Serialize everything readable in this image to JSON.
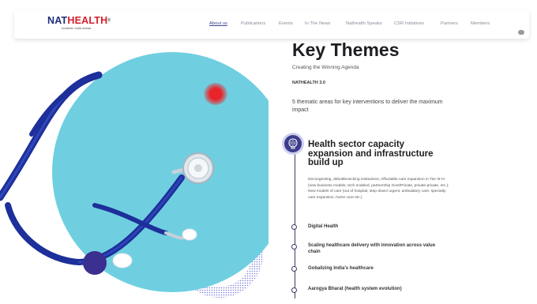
{
  "logo": {
    "name_part1": "NAT",
    "name_part2": "HEALTH",
    "trademark": "®",
    "tagline": "healthier India ahead"
  },
  "nav": {
    "items": [
      "About us",
      "Publications",
      "Events",
      "In The News",
      "Nathealth Speaks",
      "CSR Initiatives",
      "Partners",
      "Members"
    ],
    "active": "About us"
  },
  "hero": {
    "title": "Key Themes",
    "subtitle": "Creating the Winning Agenda",
    "tagline": "NATHEALTH 3.0",
    "description": "5 thematic areas for key interventions to deliver the maximum impact"
  },
  "timeline": {
    "icon": "brain-icon",
    "heading": "Health sector capacity expansion and infrastructure build up",
    "body": "Decongesting, debottlenecking institutions; Affordable care expansion in Tier III-IV (new business models, tech enabled, partnership Govt/Private, private-private, etc.); New models of care (out of hospital, step down/ urgent, ambulatory care, specialty care expansion, home care etc.)",
    "items": [
      "Digital Health",
      "Scaling healthcare delivery with innovation across value chain",
      "Gobalizing India's healthcare",
      "Aarogya Bharat (health system evolution)"
    ]
  },
  "colors": {
    "brand_navy": "#1f2d7a",
    "brand_red": "#d41f2a",
    "accent_purple": "#3b3d8a",
    "cyan": "#6fcfe0"
  }
}
